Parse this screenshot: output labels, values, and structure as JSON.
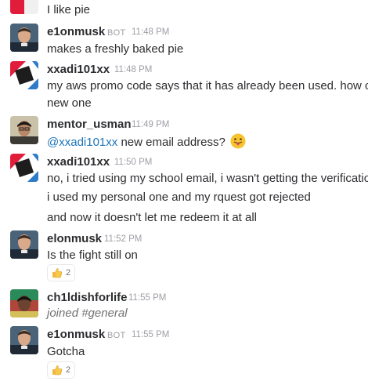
{
  "messages": [
    {
      "id": "m0",
      "lines": [
        "I like pie"
      ]
    },
    {
      "id": "m1",
      "user": "e1onmusk",
      "bot": "BOT",
      "time": "11:48 PM",
      "lines": [
        "makes a freshly baked pie"
      ]
    },
    {
      "id": "m2",
      "user": "xxadi101xx",
      "time": "11:48 PM",
      "lines": [
        "my aws promo code says that it has already been used. how co",
        "new one"
      ]
    },
    {
      "id": "m3",
      "user": "mentor_usman",
      "time": "11:49 PM",
      "mention": "@xxadi101xx",
      "text_after_mention": " new email address?",
      "emoji": "stuck-out-tongue-emoji"
    },
    {
      "id": "m4",
      "user": "xxadi101xx",
      "time": "11:50 PM",
      "lines": [
        "no, i tried using my school email, i wasn't getting the verificatio",
        "i used my personal one and my rquest got rejected",
        "and now it doesn't let me redeem it at all"
      ]
    },
    {
      "id": "m5",
      "user": "elonmusk",
      "time": "11:52 PM",
      "lines": [
        "Is the fight still on"
      ],
      "reaction": {
        "emoji": "thumbs-up-emoji",
        "count": "2"
      }
    },
    {
      "id": "m6",
      "user": "ch1ldishforlife",
      "time": "11:55 PM",
      "lines": [
        "joined #general"
      ]
    },
    {
      "id": "m7",
      "user": "e1onmusk",
      "bot": "BOT",
      "time": "11:55 PM",
      "lines": [
        "Gotcha"
      ],
      "reaction": {
        "emoji": "thumbs-up-emoji",
        "count": "2"
      }
    }
  ],
  "colors": {
    "mention": "#1d75b9",
    "name": "#2c2d30",
    "meta": "#9e9ea6",
    "xx_red": "#e01e3c",
    "xx_blue": "#2e7bc8",
    "xx_dark": "#1d1d1d"
  }
}
